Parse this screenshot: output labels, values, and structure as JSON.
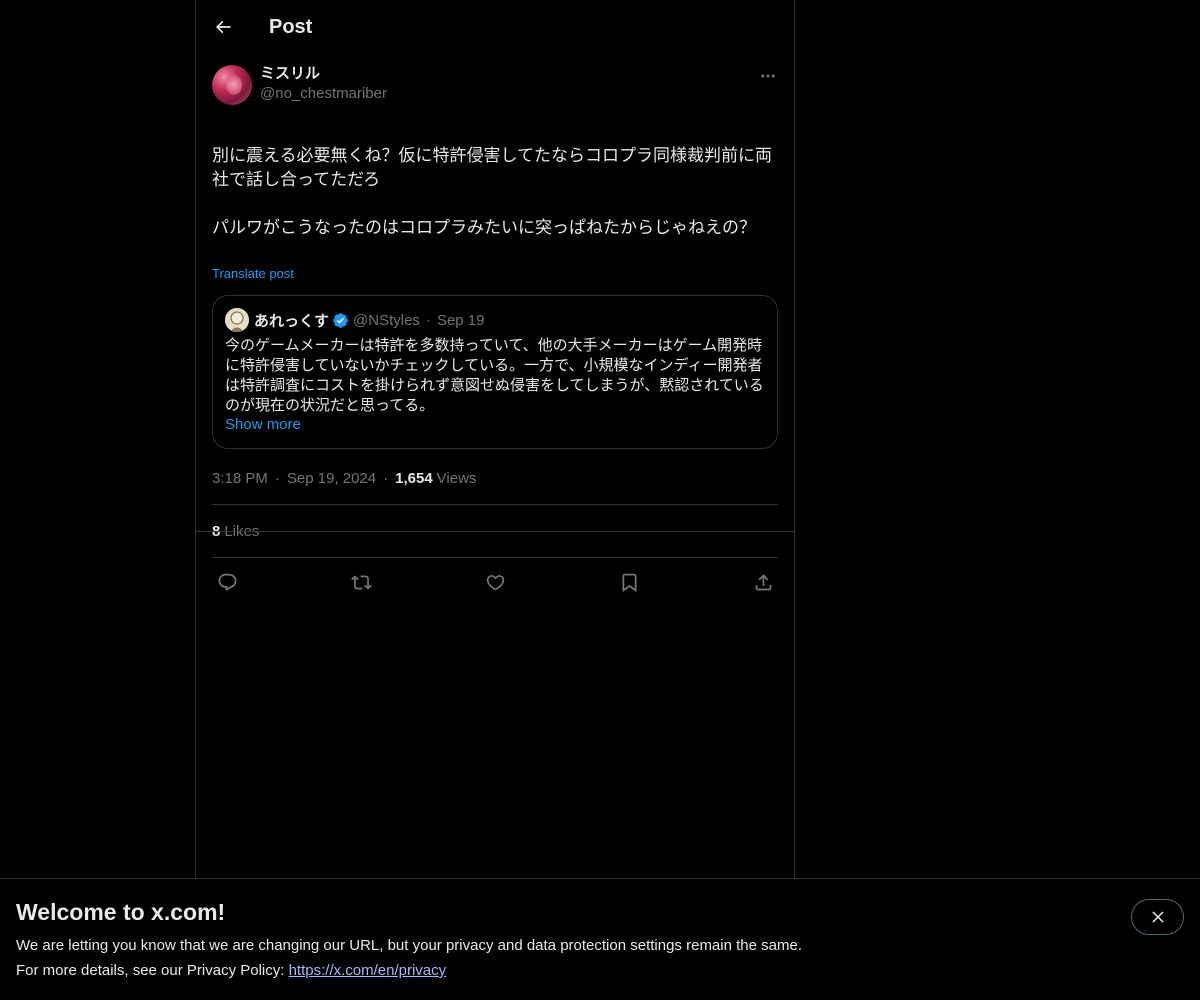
{
  "header": {
    "title": "Post"
  },
  "post": {
    "display_name": "ミスリル",
    "handle": "@no_chestmariber",
    "text_line1": "別に震える必要無くね？仮に特許侵害してたならコロプラ同様裁判前に両社で話し合ってただろ",
    "text_line2": "パルワがこうなったのはコロプラみたいに突っぱねたからじゃねえの？",
    "translate_label": "Translate post",
    "time": "3:18 PM",
    "date": "Sep 19, 2024",
    "views_count": "1,654",
    "views_label": "Views",
    "likes_count": "8",
    "likes_label": "Likes"
  },
  "quote": {
    "display_name": "あれっくす",
    "handle": "@NStyles",
    "date": "Sep 19",
    "text": "今のゲームメーカーは特許を多数持っていて、他の大手メーカーはゲーム開発時に特許侵害していないかチェックしている。一方で、小規模なインディー開発者は特許調査にコストを掛けられず意図せぬ侵害をしてしまうが、黙認されているのが現在の状況だと思ってる。",
    "show_more_label": "Show more"
  },
  "actions": {
    "icons": [
      "reply-icon",
      "repost-icon",
      "like-icon",
      "bookmark-icon",
      "share-icon"
    ]
  },
  "banner": {
    "title": "Welcome to x.com!",
    "line1": "We are letting you know that we are changing our URL, but your privacy and data protection settings remain the same.",
    "line2_prefix": "For more details, see our Privacy Policy: ",
    "link": "https://x.com/en/privacy"
  },
  "colors": {
    "background": "#000000",
    "text": "#e7e9ea",
    "muted": "#71767b",
    "accent": "#1d9bf0",
    "border": "#2f3336"
  }
}
